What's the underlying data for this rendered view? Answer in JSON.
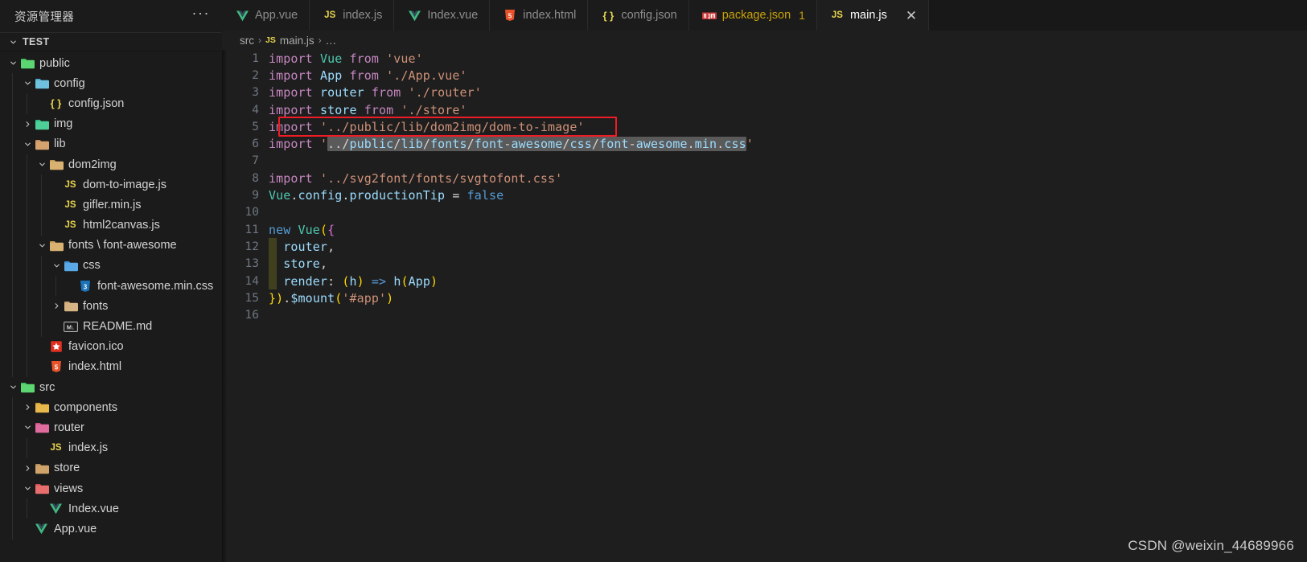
{
  "sidebar": {
    "title": "资源管理器",
    "more_label": "···",
    "section": {
      "label": "TEST",
      "expanded": true
    },
    "items": [
      {
        "label": "public",
        "icon": "folder-public",
        "indent": 1,
        "twisty": "down",
        "type": "folder"
      },
      {
        "label": "config",
        "icon": "folder-config",
        "indent": 2,
        "twisty": "down",
        "type": "folder"
      },
      {
        "label": "config.json",
        "icon": "json",
        "indent": 3,
        "twisty": "none",
        "type": "file"
      },
      {
        "label": "img",
        "icon": "folder-img",
        "indent": 2,
        "twisty": "right",
        "type": "folder"
      },
      {
        "label": "lib",
        "icon": "folder-lib",
        "indent": 2,
        "twisty": "down",
        "type": "folder"
      },
      {
        "label": "dom2img",
        "icon": "folder-plain",
        "indent": 3,
        "twisty": "down",
        "type": "folder"
      },
      {
        "label": "dom-to-image.js",
        "icon": "js",
        "indent": 4,
        "twisty": "none",
        "type": "file"
      },
      {
        "label": "gifler.min.js",
        "icon": "js",
        "indent": 4,
        "twisty": "none",
        "type": "file"
      },
      {
        "label": "html2canvas.js",
        "icon": "js",
        "indent": 4,
        "twisty": "none",
        "type": "file"
      },
      {
        "label": "fonts \\ font-awesome",
        "icon": "folder-plain",
        "indent": 3,
        "twisty": "down",
        "type": "folder"
      },
      {
        "label": "css",
        "icon": "folder-css",
        "indent": 4,
        "twisty": "down",
        "type": "folder"
      },
      {
        "label": "font-awesome.min.css",
        "icon": "css",
        "indent": 5,
        "twisty": "none",
        "type": "file"
      },
      {
        "label": "fonts",
        "icon": "folder-fonts",
        "indent": 4,
        "twisty": "right",
        "type": "folder"
      },
      {
        "label": "README.md",
        "icon": "md",
        "indent": 4,
        "twisty": "none",
        "type": "file"
      },
      {
        "label": "favicon.ico",
        "icon": "favicon",
        "indent": 3,
        "twisty": "none",
        "type": "file"
      },
      {
        "label": "index.html",
        "icon": "html",
        "indent": 3,
        "twisty": "none",
        "type": "file"
      },
      {
        "label": "src",
        "icon": "folder-src",
        "indent": 1,
        "twisty": "down",
        "type": "folder"
      },
      {
        "label": "components",
        "icon": "folder-comp",
        "indent": 2,
        "twisty": "right",
        "type": "folder"
      },
      {
        "label": "router",
        "icon": "folder-router",
        "indent": 2,
        "twisty": "down",
        "type": "folder"
      },
      {
        "label": "index.js",
        "icon": "js",
        "indent": 3,
        "twisty": "none",
        "type": "file"
      },
      {
        "label": "store",
        "icon": "folder-store",
        "indent": 2,
        "twisty": "right",
        "type": "folder"
      },
      {
        "label": "views",
        "icon": "folder-views",
        "indent": 2,
        "twisty": "down",
        "type": "folder"
      },
      {
        "label": "Index.vue",
        "icon": "vue",
        "indent": 3,
        "twisty": "none",
        "type": "file"
      },
      {
        "label": "App.vue",
        "icon": "vue",
        "indent": 2,
        "twisty": "none",
        "type": "file"
      }
    ]
  },
  "tabs": [
    {
      "label": "App.vue",
      "icon": "vue",
      "active": false,
      "badge": "",
      "dirty": false
    },
    {
      "label": "index.js",
      "icon": "js",
      "active": false,
      "badge": "",
      "dirty": false
    },
    {
      "label": "Index.vue",
      "icon": "vue",
      "active": false,
      "badge": "",
      "dirty": false
    },
    {
      "label": "index.html",
      "icon": "html",
      "active": false,
      "badge": "",
      "dirty": false
    },
    {
      "label": "config.json",
      "icon": "json",
      "active": false,
      "badge": "",
      "dirty": false
    },
    {
      "label": "package.json",
      "icon": "npm",
      "active": false,
      "badge": "1",
      "dirty": true
    },
    {
      "label": "main.js",
      "icon": "js",
      "active": true,
      "badge": "",
      "dirty": false
    }
  ],
  "tab_close_label": "✕",
  "breadcrumb": {
    "folder": "src",
    "file": "main.js",
    "file_icon": "js",
    "ellipsis": "…",
    "separator": "›"
  },
  "editor": {
    "language": "javascript",
    "total_lines": 16,
    "line_numbers": [
      "1",
      "2",
      "3",
      "4",
      "5",
      "6",
      "7",
      "8",
      "9",
      "10",
      "11",
      "12",
      "13",
      "14",
      "15",
      "16"
    ],
    "lines": [
      "import Vue from 'vue'",
      "import App from './App.vue'",
      "import router from './router'",
      "import store from './store'",
      "import '../public/lib/dom2img/dom-to-image'",
      "import '../public/lib/fonts/font-awesome/css/font-awesome.min.css'",
      "",
      "import '../svg2font/fonts/svgtofont.css'",
      "Vue.config.productionTip = false",
      "",
      "new Vue({",
      "  router,",
      "  store,",
      "  render: (h) => h(App)",
      "}).$mount('#app')",
      ""
    ],
    "highlight_box_line": 5,
    "find_highlight_line": 6,
    "find_highlight_text": "../public/lib/fonts/font-awesome/css/font-awesome.min.css"
  },
  "watermark": "CSDN @weixin_44689966",
  "colors": {
    "editor_bg": "#1e1e1e",
    "sidebar_bg": "#1b1b1b",
    "tabbar_bg": "#181818",
    "accent_red_box": "#ee1c25",
    "keyword": "#c586c0",
    "string": "#ce9178",
    "variable": "#9cdcfe",
    "blue": "#569cd6",
    "teal": "#4ec9b0",
    "find_highlight": "#5a5a5a"
  }
}
